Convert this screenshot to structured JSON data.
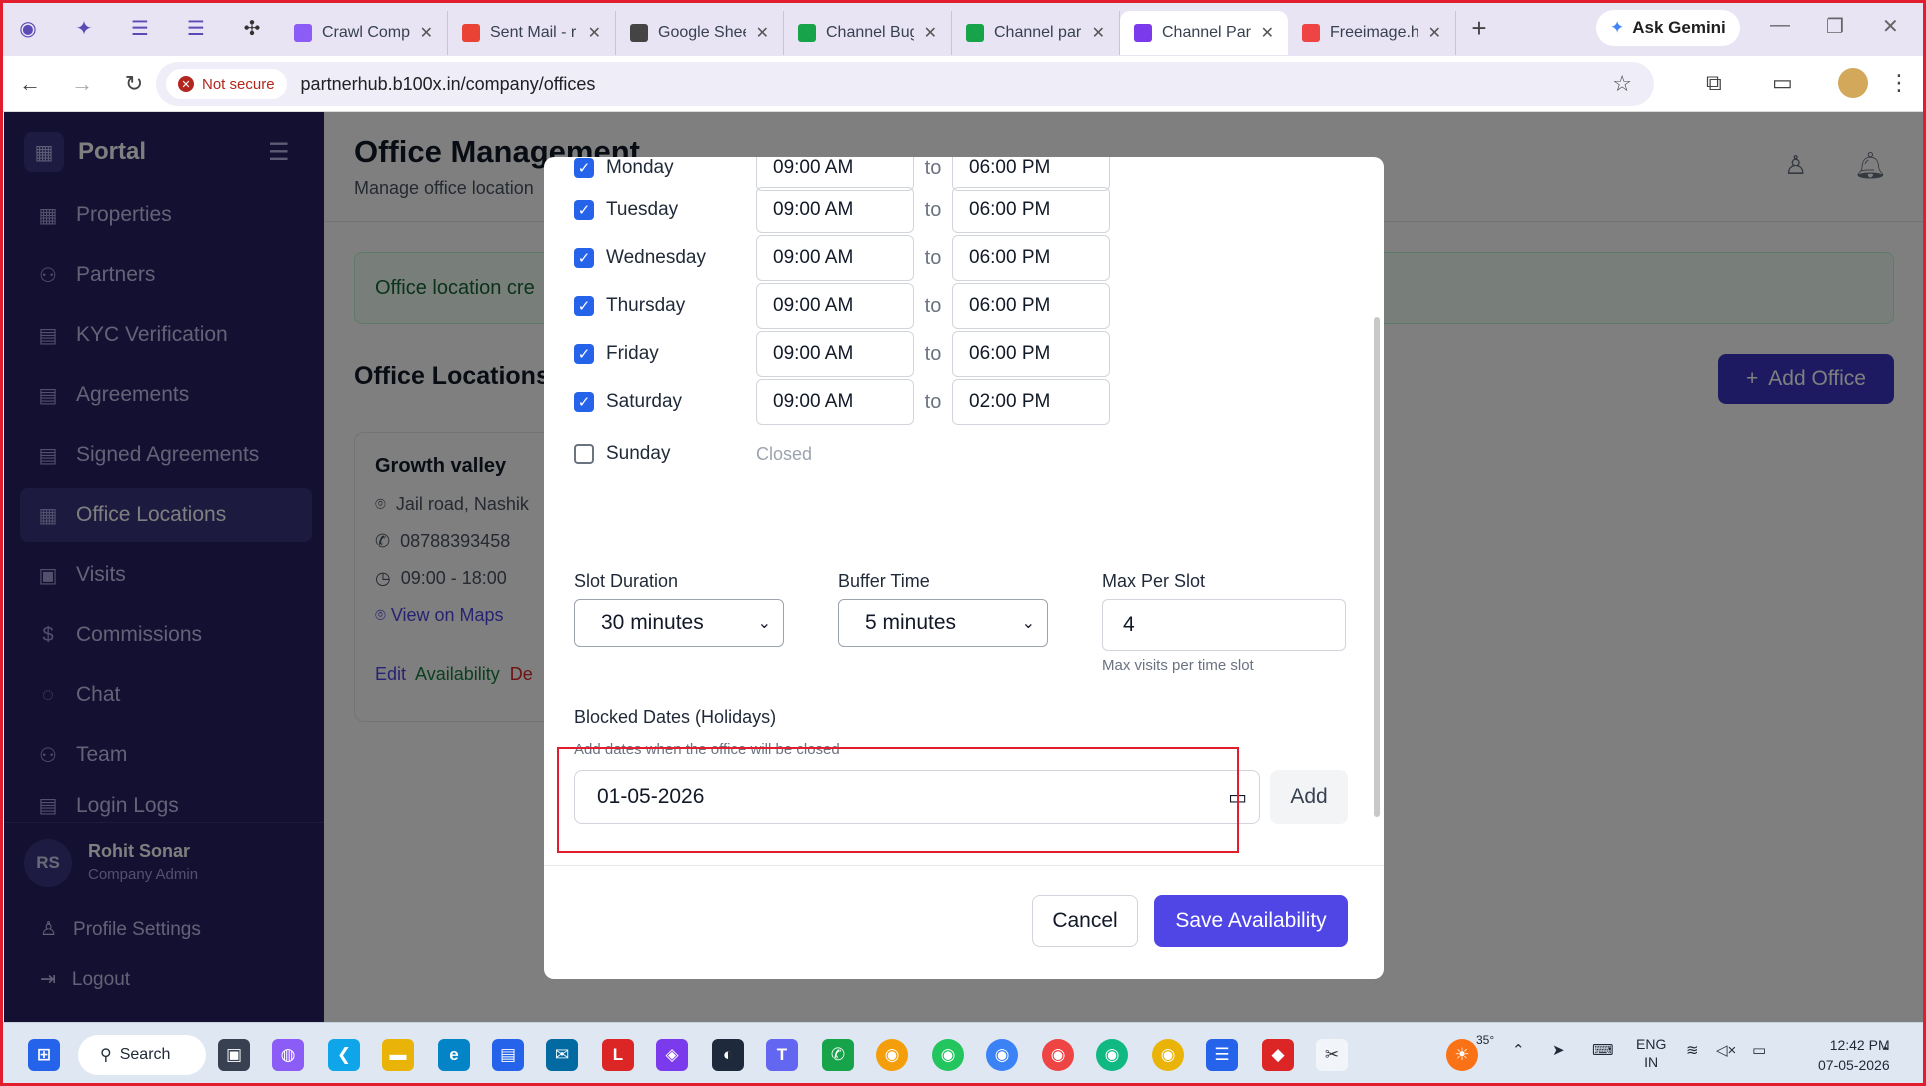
{
  "browser": {
    "tabs": [
      {
        "title": "Crawl Comp",
        "color": "#8b5cf6"
      },
      {
        "title": "Sent Mail - r",
        "color": "#ea4335"
      },
      {
        "title": "Google Shee",
        "color": "#444444"
      },
      {
        "title": "Channel Bug",
        "color": "#16a34a"
      },
      {
        "title": "Channel par",
        "color": "#16a34a"
      },
      {
        "title": "Channel Par",
        "color": "#7c3aed"
      },
      {
        "title": "Freeimage.h",
        "color": "#ef4444"
      }
    ],
    "ask_gemini": "Ask Gemini",
    "not_secure": "Not secure",
    "url": "partnerhub.b100x.in/company/offices"
  },
  "sidebar": {
    "brand": "Portal",
    "items": [
      {
        "label": "Properties",
        "icon": "building-icon"
      },
      {
        "label": "Partners",
        "icon": "users-icon"
      },
      {
        "label": "KYC Verification",
        "icon": "document-icon"
      },
      {
        "label": "Agreements",
        "icon": "document-icon"
      },
      {
        "label": "Signed Agreements",
        "icon": "document-icon"
      },
      {
        "label": "Office Locations",
        "icon": "building-icon"
      },
      {
        "label": "Visits",
        "icon": "calendar-icon"
      },
      {
        "label": "Commissions",
        "icon": "dollar-icon"
      },
      {
        "label": "Chat",
        "icon": "chat-icon"
      },
      {
        "label": "Team",
        "icon": "team-icon"
      },
      {
        "label": "Login Logs",
        "icon": "log-icon"
      }
    ],
    "user": {
      "initials": "RS",
      "name": "Rohit Sonar",
      "role": "Company Admin"
    },
    "profile_settings": "Profile Settings",
    "logout": "Logout"
  },
  "page": {
    "title": "Office Management",
    "subtitle": "Manage office location",
    "alert": "Office location cre",
    "section_title": "Office Locations",
    "add_office": "Add Office",
    "card": {
      "name": "Growth valley",
      "address": "Jail road, Nashik",
      "phone": "08788393458",
      "hours": "09:00 - 18:00",
      "maps": "View on Maps",
      "edit": "Edit",
      "availability": "Availability",
      "delete": "De"
    }
  },
  "modal": {
    "to_label": "to",
    "days": [
      {
        "name": "Monday",
        "checked": true,
        "from": "09:00 AM",
        "to": "06:00 PM"
      },
      {
        "name": "Tuesday",
        "checked": true,
        "from": "09:00 AM",
        "to": "06:00 PM"
      },
      {
        "name": "Wednesday",
        "checked": true,
        "from": "09:00 AM",
        "to": "06:00 PM"
      },
      {
        "name": "Thursday",
        "checked": true,
        "from": "09:00 AM",
        "to": "06:00 PM"
      },
      {
        "name": "Friday",
        "checked": true,
        "from": "09:00 AM",
        "to": "06:00 PM"
      },
      {
        "name": "Saturday",
        "checked": true,
        "from": "09:00 AM",
        "to": "02:00 PM"
      },
      {
        "name": "Sunday",
        "checked": false,
        "closed": "Closed"
      }
    ],
    "slot_duration": {
      "label": "Slot Duration",
      "value": "30 minutes"
    },
    "buffer_time": {
      "label": "Buffer Time",
      "value": "5 minutes"
    },
    "max_per_slot": {
      "label": "Max Per Slot",
      "value": "4",
      "hint": "Max visits per time slot"
    },
    "blocked": {
      "label": "Blocked Dates (Holidays)",
      "hint": "Add dates when the office will be closed",
      "date": "01-05-2026",
      "add": "Add"
    },
    "cancel": "Cancel",
    "save": "Save Availability"
  },
  "taskbar": {
    "search": "Search",
    "weather": "35°",
    "lang_top": "ENG",
    "lang_bottom": "IN",
    "time": "12:42 PM",
    "date": "07-05-2026",
    "badge_count": "2"
  }
}
